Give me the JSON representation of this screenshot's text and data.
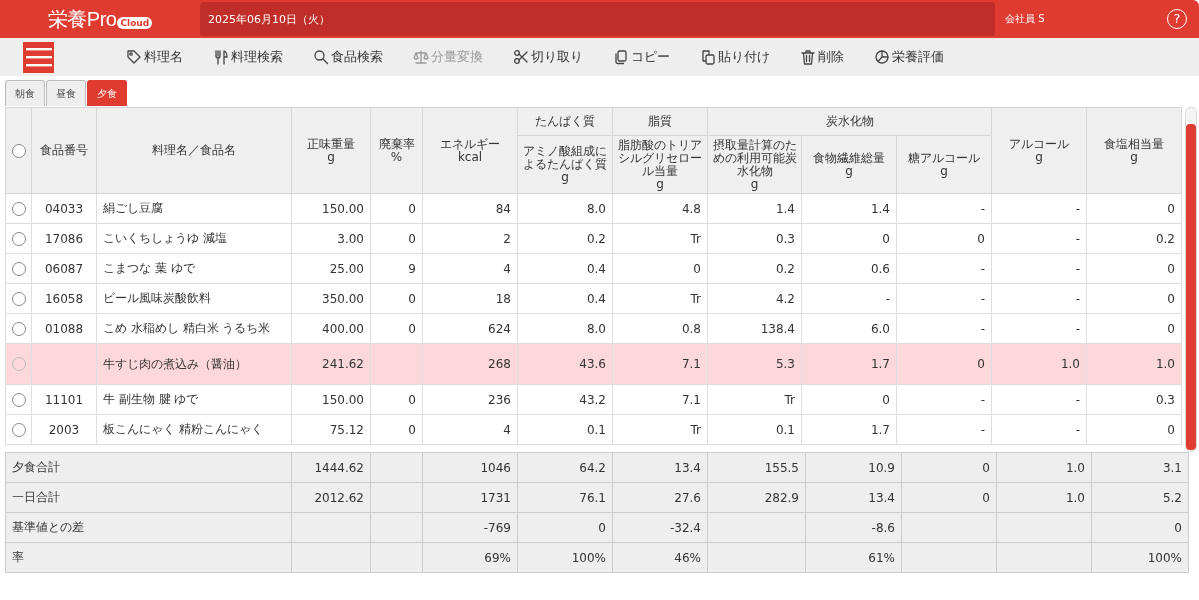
{
  "header": {
    "logo": "栄養Pro",
    "logo_badge": "Cloud",
    "date": "2025年06月10日（火）",
    "user": "会社員 S",
    "help": "?"
  },
  "toolbar": [
    {
      "label": "料理名",
      "disabled": false
    },
    {
      "label": "料理検索",
      "disabled": false
    },
    {
      "label": "食品検索",
      "disabled": false
    },
    {
      "label": "分量変換",
      "disabled": true
    },
    {
      "label": "切り取り",
      "disabled": false
    },
    {
      "label": "コピー",
      "disabled": false
    },
    {
      "label": "貼り付け",
      "disabled": false
    },
    {
      "label": "削除",
      "disabled": false
    },
    {
      "label": "栄養評価",
      "disabled": false
    }
  ],
  "tabs": [
    {
      "label": "朝食",
      "selected": false
    },
    {
      "label": "昼食",
      "selected": false
    },
    {
      "label": "夕食",
      "selected": true
    }
  ],
  "table": {
    "header_rows": [
      [
        {
          "kind": "select",
          "checked": false,
          "rowspan": 2
        },
        {
          "label": "食品番号",
          "rowspan": 2
        },
        {
          "label": "料理名／食品名",
          "rowspan": 2
        },
        {
          "label": "正味重量",
          "unit": "g",
          "rowspan": 2
        },
        {
          "label": "廃棄率",
          "unit": "%",
          "rowspan": 2
        },
        {
          "label": "エネルギー",
          "unit": "kcal",
          "rowspan": 2
        },
        {
          "label": "たんぱく質"
        },
        {
          "label": "脂質"
        },
        {
          "label": "炭水化物",
          "colspan": 3
        },
        {
          "label": "アルコール",
          "unit": "g",
          "rowspan": 2
        },
        {
          "label": "食塩相当量",
          "unit": "g",
          "rowspan": 2
        }
      ],
      [
        {
          "label": "アミノ酸組成によるたんぱく質",
          "unit": "g"
        },
        {
          "label": "脂肪酸のトリアシルグリセロール当量",
          "unit": "g"
        },
        {
          "label": "摂取量計算のための利用可能炭水化物",
          "unit": "g"
        },
        {
          "label": "食物繊維総量",
          "unit": "g"
        },
        {
          "label": "糖アルコール",
          "unit": "g"
        }
      ]
    ],
    "rows": [
      {
        "kind": "food",
        "selected": false,
        "cells": [
          "04033",
          "絹ごし豆腐",
          "150.00",
          "0",
          "84",
          "8.0",
          "4.8",
          "1.4",
          "1.4",
          "-",
          "-",
          "0"
        ]
      },
      {
        "kind": "food",
        "selected": false,
        "cells": [
          "17086",
          "こいくちしょうゆ 減塩",
          "3.00",
          "0",
          "2",
          "0.2",
          "Tr",
          "0.3",
          "0",
          "0",
          "-",
          "0.2"
        ]
      },
      {
        "kind": "food",
        "selected": false,
        "cells": [
          "06087",
          "こまつな 葉 ゆで",
          "25.00",
          "9",
          "4",
          "0.4",
          "0",
          "0.2",
          "0.6",
          "-",
          "-",
          "0"
        ]
      },
      {
        "kind": "food",
        "selected": false,
        "cells": [
          "16058",
          "ビール風味炭酸飲料",
          "350.00",
          "0",
          "18",
          "0.4",
          "Tr",
          "4.2",
          "-",
          "-",
          "-",
          "0"
        ]
      },
      {
        "kind": "food",
        "selected": false,
        "cells": [
          "01088",
          "こめ 水稲めし 精白米 うるち米",
          "400.00",
          "0",
          "624",
          "8.0",
          "0.8",
          "138.4",
          "6.0",
          "-",
          "-",
          "0"
        ]
      },
      {
        "kind": "dish",
        "selected": false,
        "cells": [
          null,
          "牛すじ肉の煮込み（醤油）",
          "241.62",
          null,
          "268",
          "43.6",
          "7.1",
          "5.3",
          "1.7",
          "0",
          "1.0",
          "1.0"
        ]
      },
      {
        "kind": "food",
        "selected": false,
        "cells": [
          "11101",
          "牛 副生物 腱 ゆで",
          "150.00",
          "0",
          "236",
          "43.2",
          "7.1",
          "Tr",
          "0",
          "-",
          "-",
          "0.3"
        ]
      },
      {
        "kind": "food",
        "selected": false,
        "cells": [
          "2003",
          "板こんにゃく 精粉こんにゃく",
          "75.12",
          "0",
          "4",
          "0.1",
          "Tr",
          "0.1",
          "1.7",
          "-",
          "-",
          "0"
        ]
      }
    ],
    "summary": [
      {
        "label": "夕食合計",
        "cells": [
          "1444.62",
          null,
          "1046",
          "64.2",
          "13.4",
          "155.5",
          "10.9",
          "0",
          "1.0",
          "3.1"
        ]
      },
      {
        "label": "一日合計",
        "cells": [
          "2012.62",
          null,
          "1731",
          "76.1",
          "27.6",
          "282.9",
          "13.4",
          "0",
          "1.0",
          "5.2"
        ]
      },
      {
        "label": "基準値との差",
        "cells": [
          null,
          null,
          "-769",
          "0",
          "-32.4",
          null,
          "-8.6",
          null,
          null,
          "0"
        ]
      },
      {
        "label": "率",
        "cells": [
          null,
          null,
          "69%",
          "100%",
          "46%",
          null,
          "61%",
          null,
          null,
          "100%"
        ]
      }
    ]
  }
}
